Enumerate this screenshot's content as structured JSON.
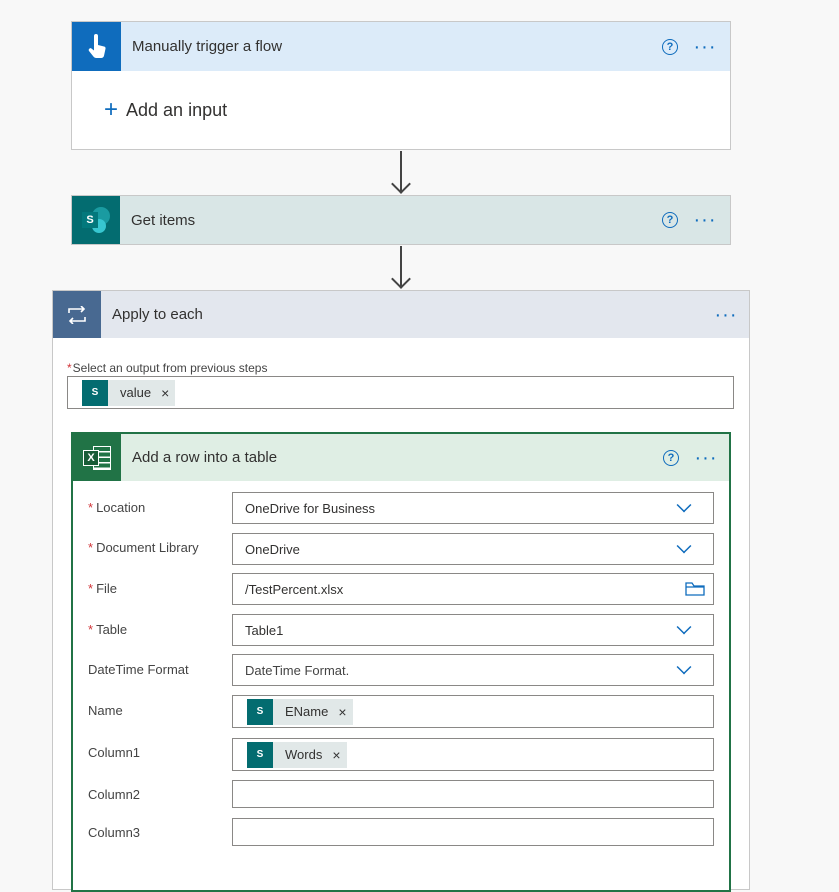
{
  "trigger": {
    "title": "Manually trigger a flow",
    "add_input": "Add an input",
    "help_label": "?",
    "more_label": "···"
  },
  "get_items": {
    "title": "Get items",
    "help_label": "?",
    "more_label": "···"
  },
  "apply_each": {
    "title": "Apply to each",
    "more_label": "···",
    "select_label": "Select an output from previous steps",
    "token": "value"
  },
  "add_row": {
    "title": "Add a row into a table",
    "help_label": "?",
    "more_label": "···",
    "fields": {
      "location": {
        "label": "Location",
        "value": "OneDrive for Business"
      },
      "library": {
        "label": "Document Library",
        "value": "OneDrive"
      },
      "file": {
        "label": "File",
        "value": "/TestPercent.xlsx"
      },
      "table": {
        "label": "Table",
        "value": "Table1"
      },
      "datetime": {
        "label": "DateTime Format",
        "placeholder": "DateTime Format."
      },
      "name": {
        "label": "Name",
        "token": "EName"
      },
      "column1": {
        "label": "Column1",
        "token": "Words"
      },
      "column2": {
        "label": "Column2",
        "value": ""
      },
      "column3": {
        "label": "Column3",
        "value": ""
      }
    }
  },
  "common": {
    "required_mark": "*",
    "remove_mark": "×",
    "sp_letter": "S",
    "xl_letter": "X"
  },
  "colors": {
    "accent": "#0f6cbd",
    "sharepoint": "#036c70",
    "excel": "#217346",
    "loop": "#486991",
    "trigger": "#0f6cbd"
  }
}
